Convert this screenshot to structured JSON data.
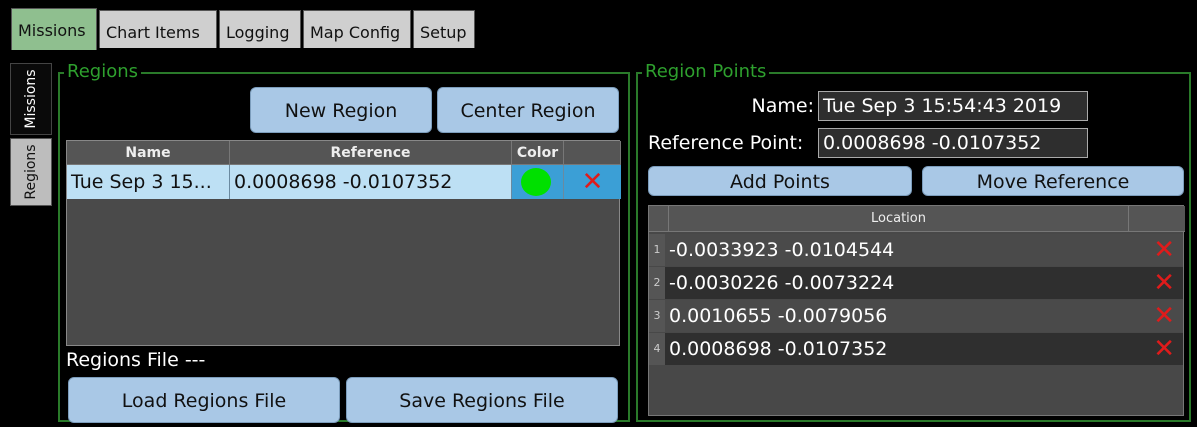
{
  "tabs": [
    "Missions",
    "Chart Items",
    "Logging",
    "Map Config",
    "Setup"
  ],
  "side_tabs": [
    "Missions",
    "Regions"
  ],
  "regions": {
    "title": "Regions",
    "new_region": "New Region",
    "center_region": "Center Region",
    "columns": [
      "Name",
      "Reference",
      "Color"
    ],
    "rows": [
      {
        "name": "Tue Sep 3 15...",
        "reference": "0.0008698 -0.0107352",
        "color": "#00e000",
        "delete": "✕"
      }
    ],
    "file_label": "Regions File ---",
    "load": "Load Regions File",
    "save": "Save Regions File"
  },
  "points": {
    "title": "Region Points",
    "name_label": "Name:",
    "name_value": "Tue Sep 3 15:54:43 2019",
    "ref_label": "Reference Point:",
    "ref_value": "0.0008698 -0.0107352",
    "add_points": "Add Points",
    "move_reference": "Move Reference",
    "column": "Location",
    "rows": [
      {
        "index": "1",
        "location": "-0.0033923 -0.0104544",
        "delete": "✕"
      },
      {
        "index": "2",
        "location": "-0.0030226 -0.0073224",
        "delete": "✕"
      },
      {
        "index": "3",
        "location": "0.0010655 -0.0079056",
        "delete": "✕"
      },
      {
        "index": "4",
        "location": "0.0008698 -0.0107352",
        "delete": "✕"
      }
    ]
  }
}
